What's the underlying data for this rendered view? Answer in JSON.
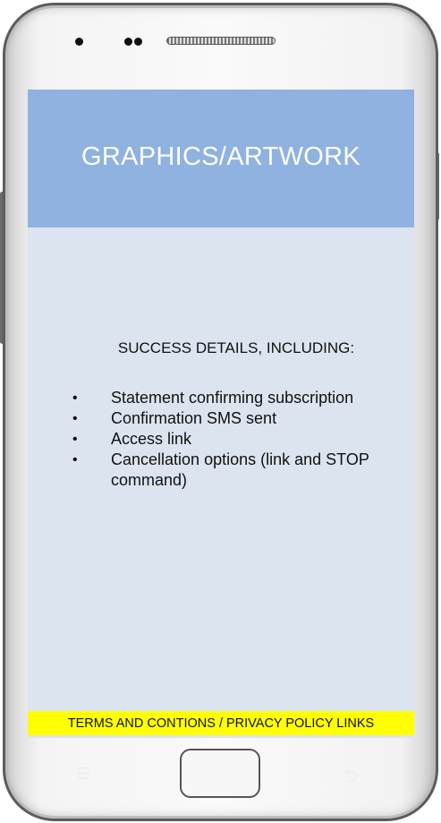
{
  "banner": {
    "text": "GRAPHICS/ARTWORK"
  },
  "content": {
    "heading": "SUCCESS DETAILS, INCLUDING:",
    "bullet_char": "•",
    "items": [
      "Statement confirming subscription",
      "Confirmation SMS sent",
      "Access link",
      "Cancellation options (link and STOP command)"
    ]
  },
  "footer": {
    "terms_text": "TERMS AND CONTIONS / PRIVACY POLICY LINKS"
  },
  "hardware": {
    "menu_icon": "menu-icon",
    "back_icon": "back-icon",
    "menu_glyph": "☰",
    "back_glyph": "⮌"
  },
  "colors": {
    "banner": "#90b2e0",
    "screen": "#dce4f0",
    "terms_highlight": "#ffff00"
  }
}
